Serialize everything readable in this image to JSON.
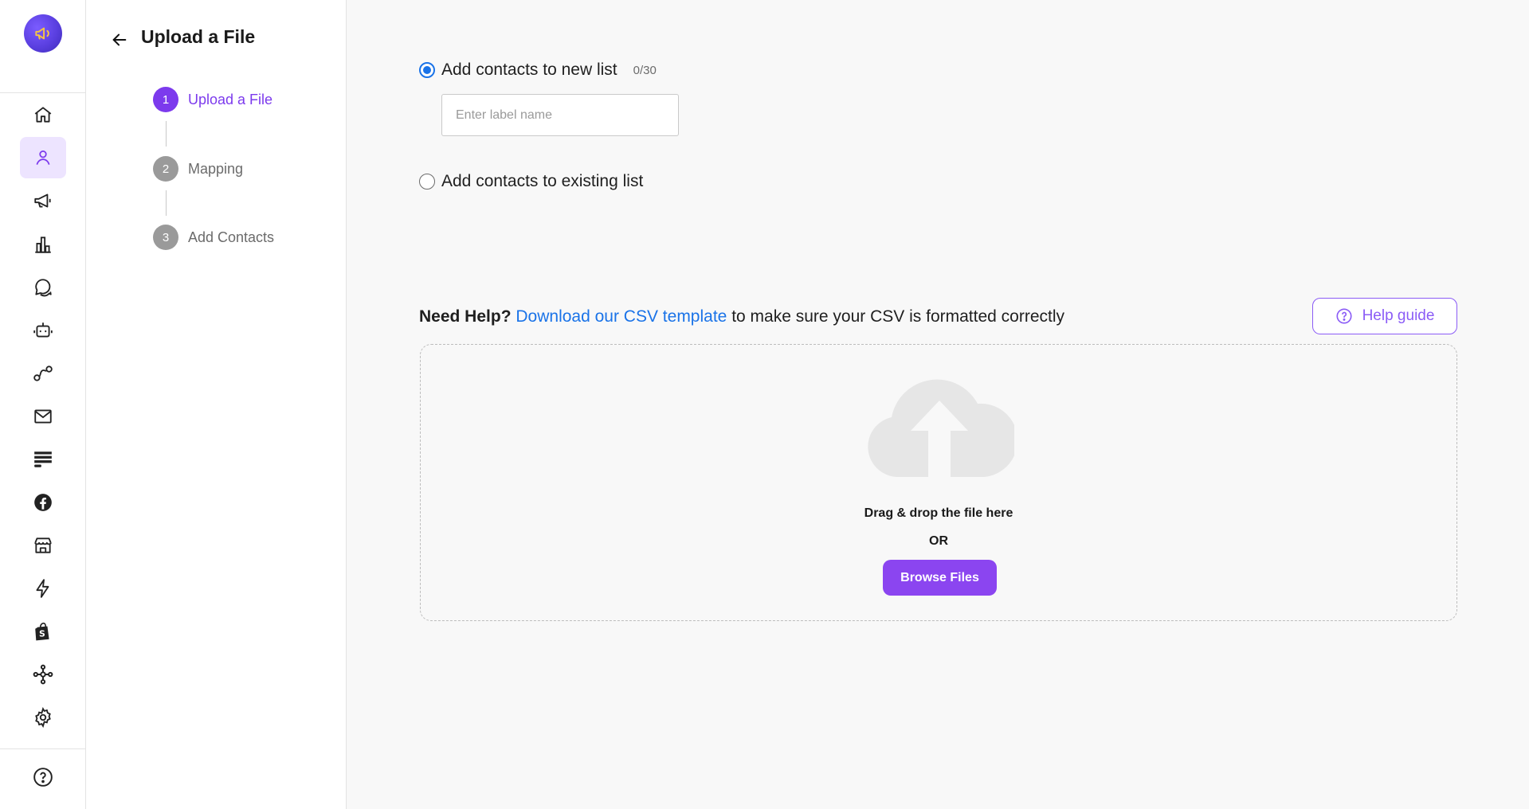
{
  "panel": {
    "title": "Upload a File",
    "steps": [
      {
        "num": "1",
        "label": "Upload a File"
      },
      {
        "num": "2",
        "label": "Mapping"
      },
      {
        "num": "3",
        "label": "Add Contacts"
      }
    ]
  },
  "rail": {
    "items": [
      "home-icon",
      "contacts-icon",
      "megaphone-icon",
      "bar-chart-icon",
      "chat-icon",
      "bot-icon",
      "flow-icon",
      "mail-icon",
      "forms-icon",
      "facebook-icon",
      "store-icon",
      "lightning-icon",
      "shopify-icon",
      "integrations-icon",
      "gear-icon"
    ],
    "active": "contacts-icon",
    "bottom": "help-icon"
  },
  "options": {
    "new_list_label": "Add contacts to new list",
    "counter": "0/30",
    "label_placeholder": "Enter label name",
    "existing_list_label": "Add contacts to existing list"
  },
  "help": {
    "strong": "Need Help?",
    "link": "Download our CSV template",
    "rest": " to make sure your CSV is formatted correctly",
    "guide_label": "Help guide"
  },
  "dropzone": {
    "drag_text": "Drag & drop the file here",
    "or_text": "OR",
    "browse_label": "Browse Files"
  },
  "colors": {
    "accent": "#7c3aed",
    "link": "#1a73e8",
    "button": "#8b45f0"
  }
}
